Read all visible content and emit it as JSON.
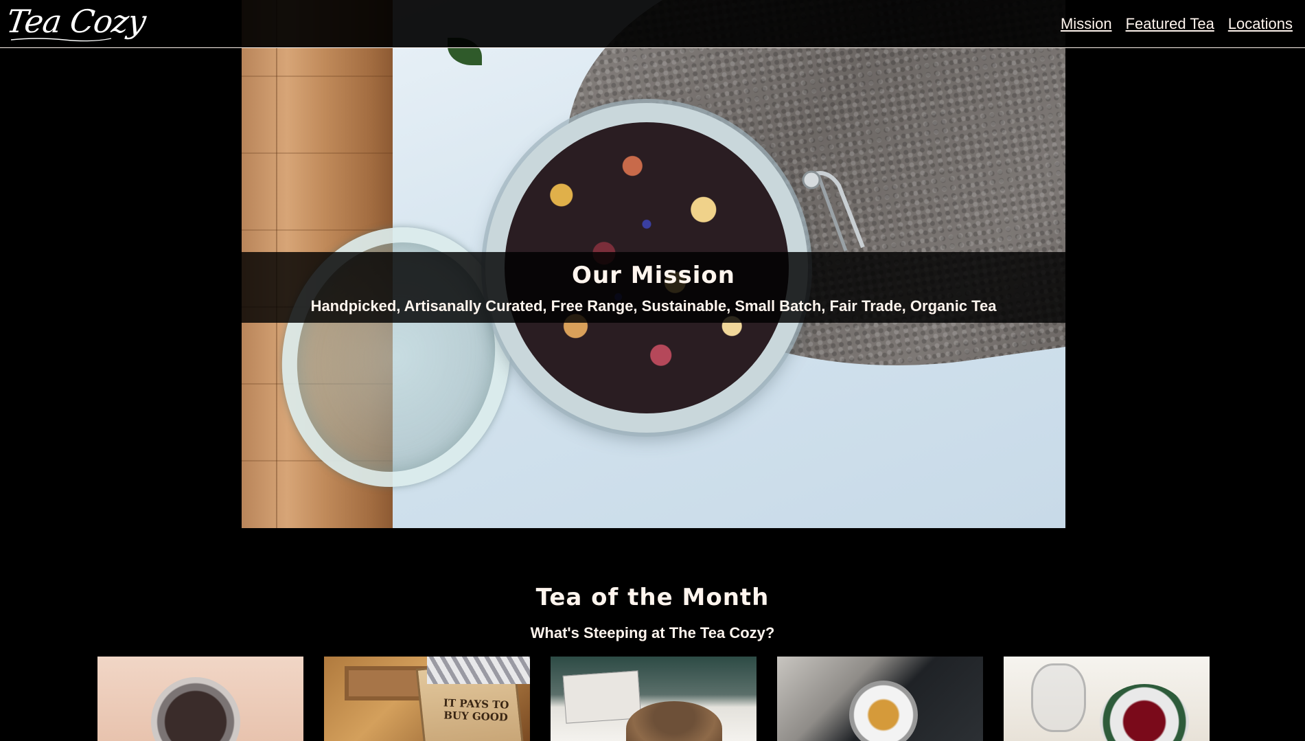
{
  "header": {
    "logo_text": "Tea Cozy",
    "nav": [
      {
        "label": "Mission"
      },
      {
        "label": "Featured Tea"
      },
      {
        "label": "Locations"
      }
    ]
  },
  "hero": {
    "title": "Our Mission",
    "subtitle": "Handpicked, Artisanally Curated, Free Range, Sustainable, Small Batch, Fair Trade, Organic Tea"
  },
  "tea_of_month": {
    "title": "Tea of the Month",
    "subtitle": "What's Steeping at The Tea Cozy?",
    "tile_box_text": "IT PAYS TO BUY GOOD"
  },
  "colors": {
    "background": "#000000",
    "text": "#FFF5EE"
  }
}
